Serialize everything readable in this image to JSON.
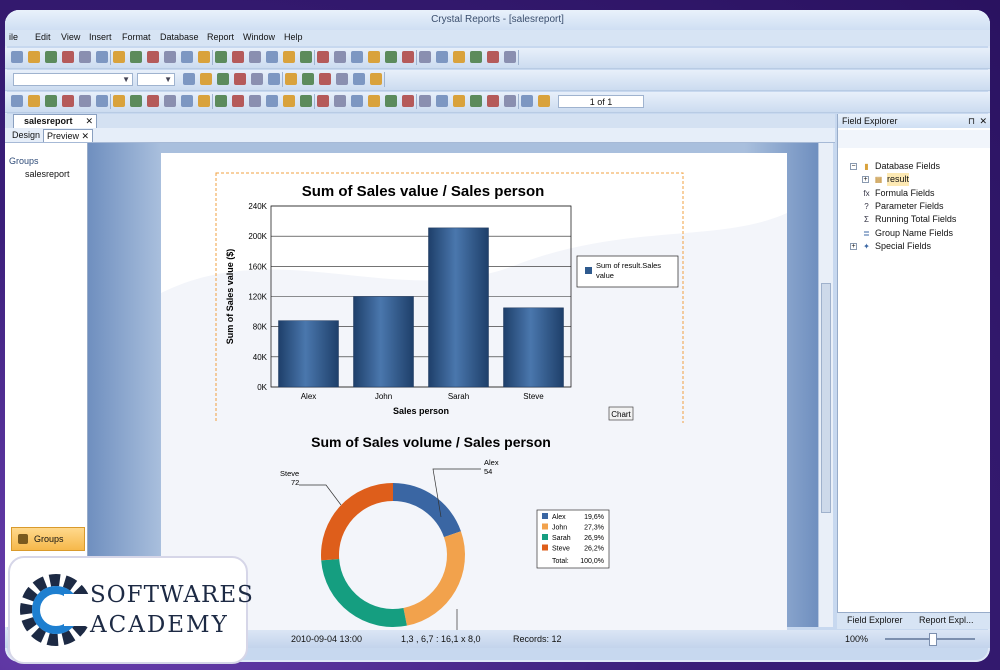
{
  "window": {
    "title": "Crystal Reports - [salesreport]"
  },
  "menu": [
    "ile",
    "Edit",
    "View",
    "Insert",
    "Format",
    "Database",
    "Report",
    "Window",
    "Help"
  ],
  "toolbar": {
    "page_indicator": "1 of 1"
  },
  "doc_tab": {
    "label": "salesreport",
    "close": "✕"
  },
  "view_tabs": {
    "design": "Design",
    "preview": "Preview",
    "close": "✕"
  },
  "groups_panel": {
    "title": "Groups",
    "item": "salesreport",
    "button": "Groups"
  },
  "chart_data": [
    {
      "type": "bar",
      "title": "Sum of Sales value / Sales person",
      "xlabel": "Sales person",
      "ylabel": "Sum of Sales value ($)",
      "categories": [
        "Alex",
        "John",
        "Sarah",
        "Steve"
      ],
      "series": [
        {
          "name": "Sum of result.Sales value",
          "values": [
            88000,
            120000,
            211000,
            105000
          ]
        }
      ],
      "ylim": [
        0,
        240000
      ],
      "yticks": [
        "0K",
        "40K",
        "80K",
        "120K",
        "160K",
        "200K",
        "240K"
      ],
      "grid": true,
      "legend": "right",
      "badge": "Chart",
      "color": "#2f5a8e"
    },
    {
      "type": "pie",
      "variant": "donut",
      "title": "Sum of Sales volume / Sales person",
      "categories": [
        "Alex",
        "John",
        "Sarah",
        "Steve"
      ],
      "values": [
        54,
        75,
        74,
        72
      ],
      "slice_labels": [
        {
          "name": "Alex",
          "value": "54"
        },
        {
          "name": "Steve",
          "value": "72"
        }
      ],
      "legend_entries": [
        {
          "name": "Alex",
          "pct": "19,6%"
        },
        {
          "name": "John",
          "pct": "27,3%"
        },
        {
          "name": "Sarah",
          "pct": "26,9%"
        },
        {
          "name": "Steve",
          "pct": "26,2%"
        }
      ],
      "legend_total": {
        "label": "Total:",
        "pct": "100,0%"
      },
      "colors": [
        "#3a66a3",
        "#f2a24c",
        "#159e80",
        "#de5e1b"
      ]
    }
  ],
  "field_explorer": {
    "title": "Field Explorer",
    "items": [
      {
        "label": "Database Fields",
        "icon": "database-icon"
      },
      {
        "label": "result",
        "icon": "table-icon"
      },
      {
        "label": "Formula Fields",
        "icon": "formula-icon"
      },
      {
        "label": "Parameter Fields",
        "icon": "parameter-icon"
      },
      {
        "label": "Running Total Fields",
        "icon": "sigma-icon"
      },
      {
        "label": "Group Name Fields",
        "icon": "group-icon"
      },
      {
        "label": "Special Fields",
        "icon": "special-icon"
      }
    ],
    "tabs": [
      "Field Explorer",
      "Report Expl..."
    ]
  },
  "status": {
    "datetime": "2010-09-04  13:00",
    "coords": "1,3 , 6,7 : 16,1 x 8,0",
    "records": "Records:  12",
    "zoom": "100%"
  },
  "logo": {
    "line1": "SOFTWARES",
    "line2": "ACADEMY"
  }
}
